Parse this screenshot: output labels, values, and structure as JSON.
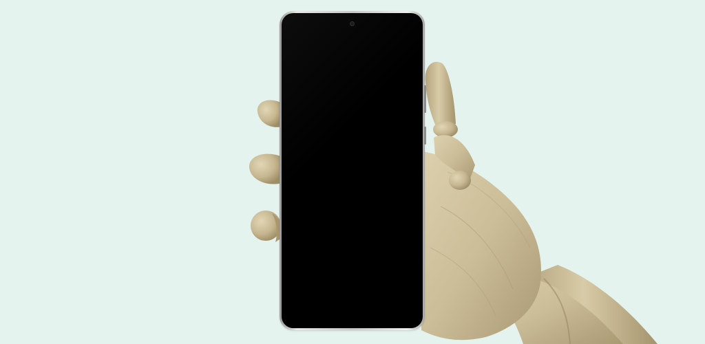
{
  "scene": {
    "background_color": "#e5f3ee",
    "subject": "wooden-mannequin-hand",
    "object": "smartphone",
    "wood_color": "#cdbf9b",
    "wood_shadow_color": "#a89872",
    "phone_frame_color": "#d9d9d7",
    "phone_screen_color": "#000000"
  }
}
